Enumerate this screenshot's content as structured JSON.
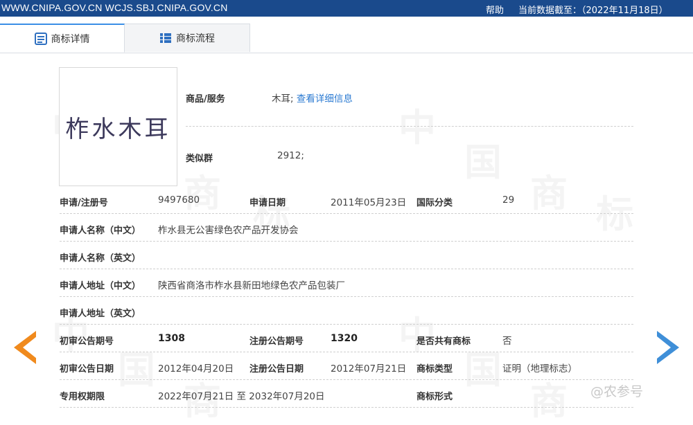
{
  "topbar": {
    "url": "WWW.CNIPA.GOV.CN WCJS.SBJ.CNIPA.GOV.CN",
    "help": "帮助",
    "data_as_of": "当前数据截至：（2022年11月18日）"
  },
  "tabs": [
    {
      "label": "商标详情",
      "active": true
    },
    {
      "label": "商标流程",
      "active": false
    }
  ],
  "logo": {
    "text": "柞水木耳"
  },
  "goods": {
    "label": "商品/服务",
    "value": "木耳;",
    "link": "查看详细信息"
  },
  "similar_group": {
    "label": "类似群",
    "value": "2912;"
  },
  "rows": {
    "reg_no": {
      "label": "申请/注册号",
      "value": "9497680"
    },
    "app_date": {
      "label": "申请日期",
      "value": "2011年05月23日"
    },
    "intl_class": {
      "label": "国际分类",
      "value": "29"
    },
    "applicant_cn": {
      "label": "申请人名称（中文）",
      "value": "柞水县无公害绿色农产品开发协会"
    },
    "applicant_en": {
      "label": "申请人名称（英文）",
      "value": ""
    },
    "address_cn": {
      "label": "申请人地址（中文）",
      "value": "陕西省商洛市柞水县新田地绿色农产品包装厂"
    },
    "address_en": {
      "label": "申请人地址（英文）",
      "value": ""
    },
    "prelim_issue": {
      "label": "初审公告期号",
      "value": "1308"
    },
    "reg_issue": {
      "label": "注册公告期号",
      "value": "1320"
    },
    "shared": {
      "label": "是否共有商标",
      "value": "否"
    },
    "prelim_date": {
      "label": "初审公告日期",
      "value": "2012年04月20日"
    },
    "reg_date": {
      "label": "注册公告日期",
      "value": "2012年07月21日"
    },
    "tm_type": {
      "label": "商标类型",
      "value": "证明（地理标志）"
    },
    "term": {
      "label": "专用权期限",
      "value": "2022年07月21日 至 2032年07月20日"
    },
    "tm_form": {
      "label": "商标形式",
      "value": ""
    }
  },
  "badge": "@农参号",
  "colors": {
    "topbar": "#1a4a8c",
    "tab_accent": "#3a8ee6",
    "link": "#2c7bd2",
    "arrow_prev": "#f08a1d",
    "arrow_next": "#3f8fd8"
  }
}
